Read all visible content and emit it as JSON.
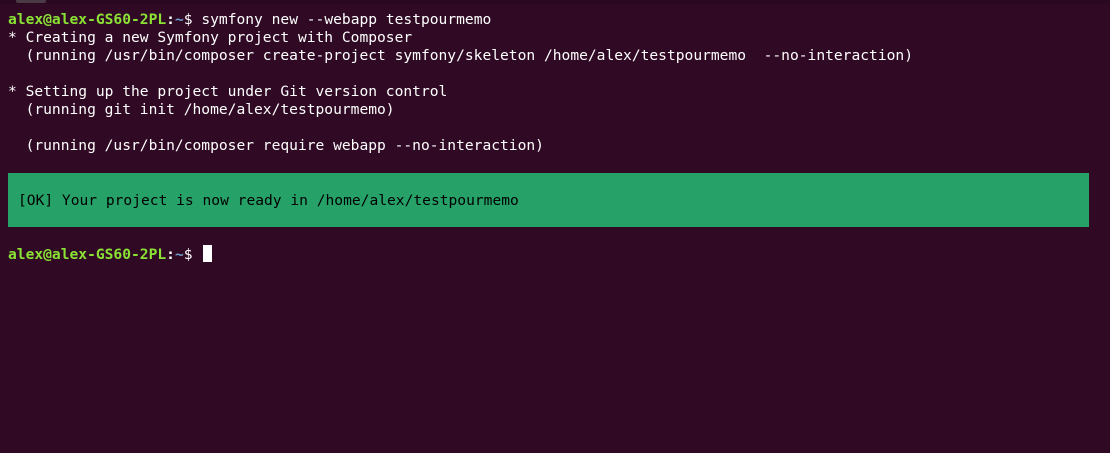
{
  "prompt": {
    "user_host": "alex@alex-GS60-2PL",
    "separator": ":",
    "path": "~",
    "symbol": "$"
  },
  "command": " symfony new --webapp testpourmemo",
  "output": {
    "line1": "* Creating a new Symfony project with Composer",
    "line2": "  (running /usr/bin/composer create-project symfony/skeleton /home/alex/testpourmemo  --no-interaction)",
    "line3": "* Setting up the project under Git version control",
    "line4": "  (running git init /home/alex/testpourmemo)",
    "line5": "  (running /usr/bin/composer require webapp --no-interaction)",
    "ok_message": "[OK] Your project is now ready in /home/alex/testpourmemo"
  },
  "colors": {
    "background": "#300a24",
    "ok_background": "#26a269",
    "prompt_user": "#8ae234",
    "prompt_path": "#729fcf"
  }
}
